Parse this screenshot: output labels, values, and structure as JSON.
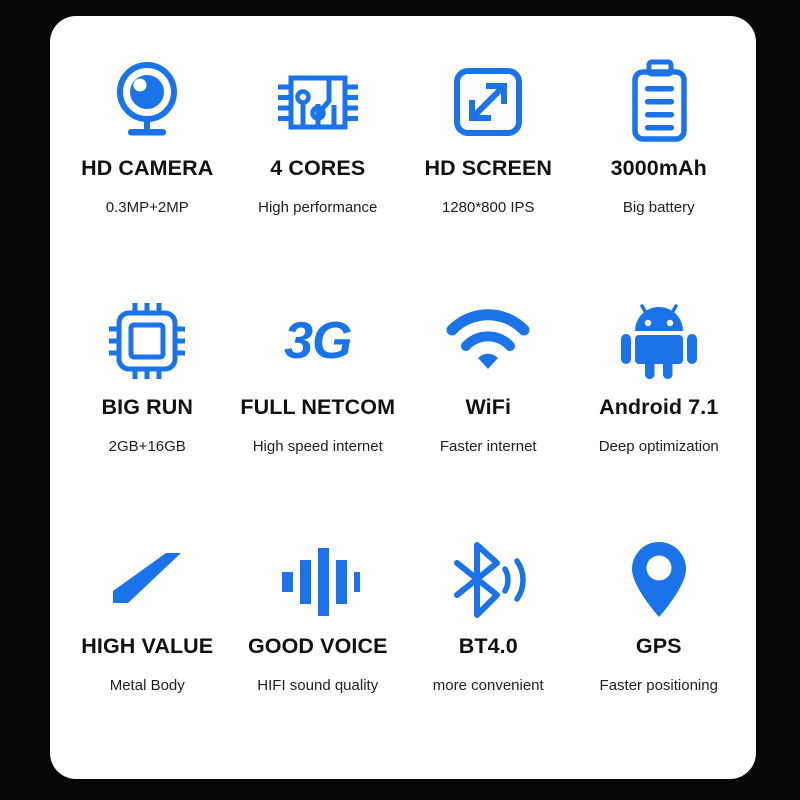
{
  "theme": {
    "page_background": "#060608",
    "card_background": "#ffffff",
    "accent": "#1a73e8",
    "icon_blue": "#1a73e8",
    "title_color": "#111111",
    "subtitle_color": "#212121"
  },
  "grid": {
    "columns": 4,
    "rows": 3,
    "features": [
      {
        "icon": "webcam-icon",
        "title": "HD CAMERA",
        "subtitle": "0.3MP+2MP"
      },
      {
        "icon": "chip-circuit-icon",
        "title": "4 CORES",
        "subtitle": "High performance"
      },
      {
        "icon": "expand-screen-icon",
        "title": "HD SCREEN",
        "subtitle": "1280*800 IPS"
      },
      {
        "icon": "battery-icon",
        "title": "3000mAh",
        "subtitle": "Big battery"
      },
      {
        "icon": "cpu-icon",
        "title": "BIG RUN",
        "subtitle": "2GB+16GB"
      },
      {
        "icon": "3g-text-icon",
        "icon_text": "3G",
        "title": "FULL NETCOM",
        "subtitle": "High speed internet"
      },
      {
        "icon": "wifi-icon",
        "title": "WiFi",
        "subtitle": "Faster internet"
      },
      {
        "icon": "android-robot-icon",
        "title": "Android 7.1",
        "subtitle": "Deep optimization"
      },
      {
        "icon": "metal-bar-icon",
        "title": "HIGH VALUE",
        "subtitle": "Metal Body"
      },
      {
        "icon": "sound-wave-icon",
        "title": "GOOD VOICE",
        "subtitle": "HIFI sound quality"
      },
      {
        "icon": "bluetooth-icon",
        "title": "BT4.0",
        "subtitle": "more convenient"
      },
      {
        "icon": "map-pin-icon",
        "title": "GPS",
        "subtitle": "Faster positioning"
      }
    ]
  }
}
